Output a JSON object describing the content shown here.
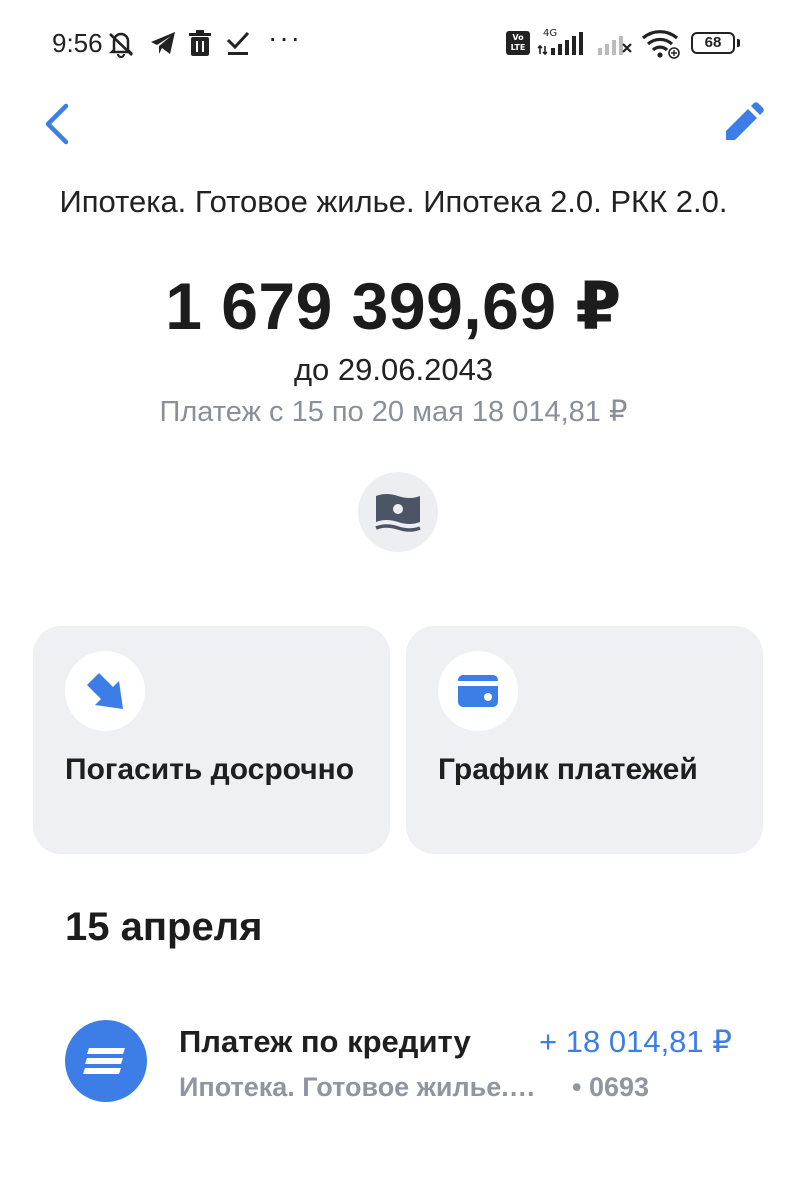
{
  "status_bar": {
    "time": "9:56",
    "icons": [
      "mute-bell-icon",
      "telegram-icon",
      "trash-icon",
      "download-done-icon",
      "more-dots-icon",
      "volte-icon",
      "signal-4g-icon",
      "signal-empty-icon",
      "wifi-icon",
      "battery-icon"
    ],
    "dots": "···",
    "volte_top": "Vo",
    "volte_bottom": "LTE",
    "network": "4G",
    "battery": "68"
  },
  "nav": {
    "back_icon": "chevron-left-icon",
    "edit_icon": "pencil-icon",
    "accent": "#3d7ee6"
  },
  "loan": {
    "title": "Ипотека. Готовое жилье. Ипотека 2.0. РКК 2.0.",
    "balance": "1 679 399,69 ₽",
    "due": "до 29.06.2043",
    "next_payment": "Платеж с 15 по 20 мая 18 014,81 ₽",
    "money_icon": "banknote-icon"
  },
  "actions": [
    {
      "label": "Погасить досрочно",
      "icon": "arrow-down-right-icon"
    },
    {
      "label": "График платежей",
      "icon": "card-icon"
    }
  ],
  "history": {
    "date": "15 апреля",
    "transactions": [
      {
        "title": "Платеж по кредиту",
        "amount": "+ 18 014,81 ₽",
        "subtitle": "Ипотека. Готовое жилье.…",
        "card": "• 0693",
        "icon": "stripes-icon",
        "amount_color": "#3d7ee6"
      }
    ]
  }
}
